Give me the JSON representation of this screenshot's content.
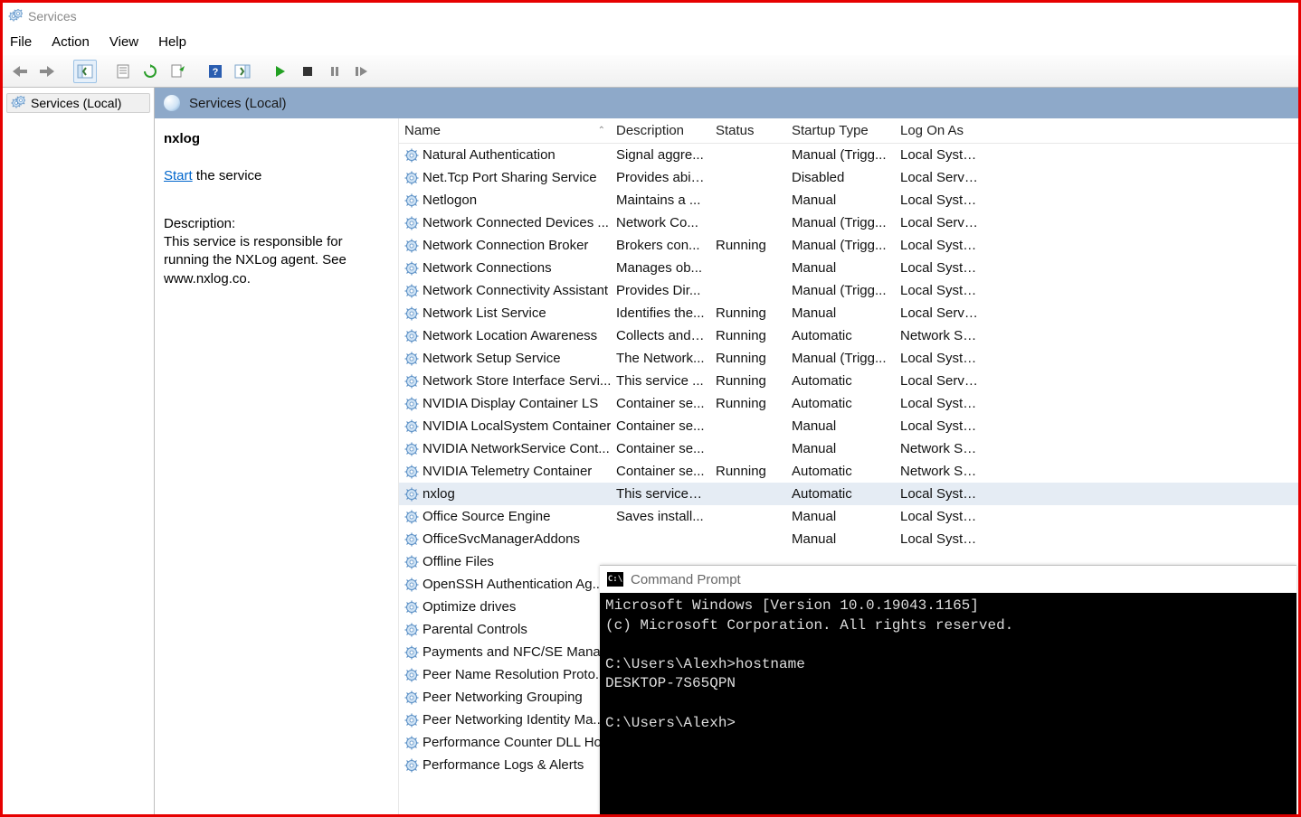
{
  "window": {
    "title": "Services"
  },
  "menu": {
    "file": "File",
    "action": "Action",
    "view": "View",
    "help": "Help"
  },
  "tree": {
    "root": "Services (Local)"
  },
  "content_header": "Services (Local)",
  "detail": {
    "name": "nxlog",
    "start_word": "Start",
    "start_rest": " the service",
    "desc_label": "Description:",
    "desc_text": "This service is responsible for running the NXLog agent. See www.nxlog.co."
  },
  "columns": {
    "name": "Name",
    "desc": "Description",
    "status": "Status",
    "startup": "Startup Type",
    "logon": "Log On As"
  },
  "services": [
    {
      "name": "Natural Authentication",
      "desc": "Signal aggre...",
      "status": "",
      "startup": "Manual (Trigg...",
      "logon": "Local System"
    },
    {
      "name": "Net.Tcp Port Sharing Service",
      "desc": "Provides abil...",
      "status": "",
      "startup": "Disabled",
      "logon": "Local Service"
    },
    {
      "name": "Netlogon",
      "desc": "Maintains a ...",
      "status": "",
      "startup": "Manual",
      "logon": "Local System"
    },
    {
      "name": "Network Connected Devices ...",
      "desc": "Network Co...",
      "status": "",
      "startup": "Manual (Trigg...",
      "logon": "Local Service"
    },
    {
      "name": "Network Connection Broker",
      "desc": "Brokers con...",
      "status": "Running",
      "startup": "Manual (Trigg...",
      "logon": "Local System"
    },
    {
      "name": "Network Connections",
      "desc": "Manages ob...",
      "status": "",
      "startup": "Manual",
      "logon": "Local System"
    },
    {
      "name": "Network Connectivity Assistant",
      "desc": "Provides Dir...",
      "status": "",
      "startup": "Manual (Trigg...",
      "logon": "Local System"
    },
    {
      "name": "Network List Service",
      "desc": "Identifies the...",
      "status": "Running",
      "startup": "Manual",
      "logon": "Local Service"
    },
    {
      "name": "Network Location Awareness",
      "desc": "Collects and ...",
      "status": "Running",
      "startup": "Automatic",
      "logon": "Network Se..."
    },
    {
      "name": "Network Setup Service",
      "desc": "The Network...",
      "status": "Running",
      "startup": "Manual (Trigg...",
      "logon": "Local System"
    },
    {
      "name": "Network Store Interface Servi...",
      "desc": "This service ...",
      "status": "Running",
      "startup": "Automatic",
      "logon": "Local Service"
    },
    {
      "name": "NVIDIA Display Container LS",
      "desc": "Container se...",
      "status": "Running",
      "startup": "Automatic",
      "logon": "Local System"
    },
    {
      "name": "NVIDIA LocalSystem Container",
      "desc": "Container se...",
      "status": "",
      "startup": "Manual",
      "logon": "Local System"
    },
    {
      "name": "NVIDIA NetworkService Cont...",
      "desc": "Container se...",
      "status": "",
      "startup": "Manual",
      "logon": "Network Se..."
    },
    {
      "name": "NVIDIA Telemetry Container",
      "desc": "Container se...",
      "status": "Running",
      "startup": "Automatic",
      "logon": "Network Se..."
    },
    {
      "name": "nxlog",
      "desc": "This service i...",
      "status": "",
      "startup": "Automatic",
      "logon": "Local System",
      "selected": true
    },
    {
      "name": "Office  Source Engine",
      "desc": "Saves install...",
      "status": "",
      "startup": "Manual",
      "logon": "Local System"
    },
    {
      "name": "OfficeSvcManagerAddons",
      "desc": "",
      "status": "",
      "startup": "Manual",
      "logon": "Local System"
    },
    {
      "name": "Offline Files",
      "desc": "",
      "status": "",
      "startup": "",
      "logon": ""
    },
    {
      "name": "OpenSSH Authentication Ag...",
      "desc": "",
      "status": "",
      "startup": "",
      "logon": ""
    },
    {
      "name": "Optimize drives",
      "desc": "",
      "status": "",
      "startup": "",
      "logon": ""
    },
    {
      "name": "Parental Controls",
      "desc": "",
      "status": "",
      "startup": "",
      "logon": ""
    },
    {
      "name": "Payments and NFC/SE Mana...",
      "desc": "",
      "status": "",
      "startup": "",
      "logon": ""
    },
    {
      "name": "Peer Name Resolution Proto...",
      "desc": "",
      "status": "",
      "startup": "",
      "logon": ""
    },
    {
      "name": "Peer Networking Grouping",
      "desc": "",
      "status": "",
      "startup": "",
      "logon": ""
    },
    {
      "name": "Peer Networking Identity Ma...",
      "desc": "",
      "status": "",
      "startup": "",
      "logon": ""
    },
    {
      "name": "Performance Counter DLL Ho...",
      "desc": "",
      "status": "",
      "startup": "",
      "logon": ""
    },
    {
      "name": "Performance Logs & Alerts",
      "desc": "",
      "status": "",
      "startup": "",
      "logon": ""
    }
  ],
  "cmd": {
    "title": "Command Prompt",
    "line1": "Microsoft Windows [Version 10.0.19043.1165]",
    "line2": "(c) Microsoft Corporation. All rights reserved.",
    "line3": "",
    "line4": "C:\\Users\\Alexh>hostname",
    "line5": "DESKTOP-7S65QPN",
    "line6": "",
    "line7": "C:\\Users\\Alexh>"
  }
}
